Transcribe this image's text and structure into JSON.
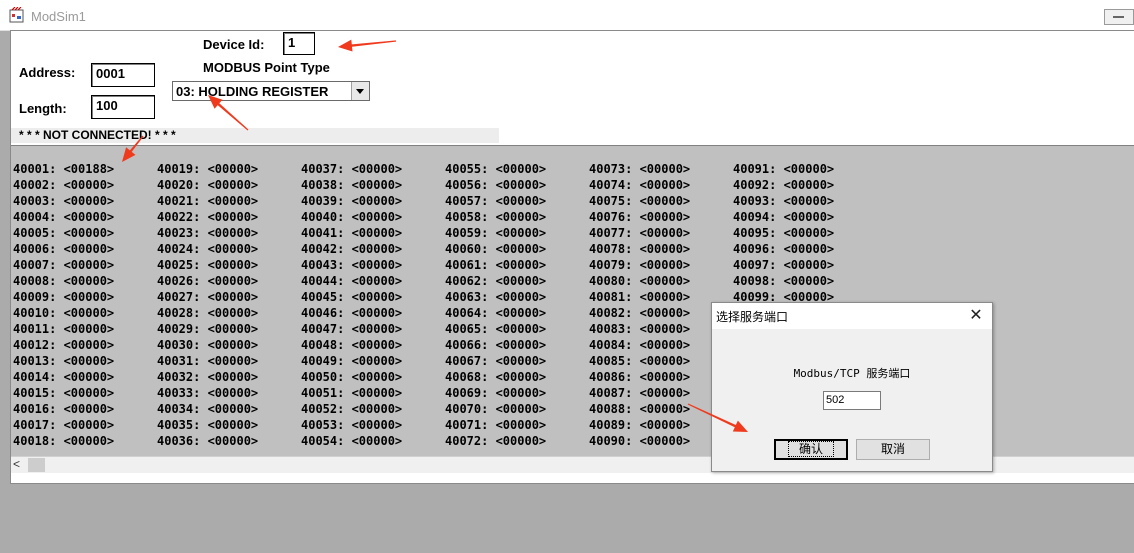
{
  "window": {
    "title": "ModSim1"
  },
  "form": {
    "device_id_label": "Device Id:",
    "device_id_value": "1",
    "point_type_label": "MODBUS Point Type",
    "point_type_value": "03: HOLDING REGISTER",
    "address_label": "Address:",
    "address_value": "0001",
    "length_label": "Length:",
    "length_value": "100",
    "status": "* * * NOT CONNECTED! * * *"
  },
  "registers": [
    [
      "40001: <00188>",
      "40002: <00000>",
      "40003: <00000>",
      "40004: <00000>",
      "40005: <00000>",
      "40006: <00000>",
      "40007: <00000>",
      "40008: <00000>",
      "40009: <00000>",
      "40010: <00000>",
      "40011: <00000>",
      "40012: <00000>",
      "40013: <00000>",
      "40014: <00000>",
      "40015: <00000>",
      "40016: <00000>",
      "40017: <00000>",
      "40018: <00000>"
    ],
    [
      "40019: <00000>",
      "40020: <00000>",
      "40021: <00000>",
      "40022: <00000>",
      "40023: <00000>",
      "40024: <00000>",
      "40025: <00000>",
      "40026: <00000>",
      "40027: <00000>",
      "40028: <00000>",
      "40029: <00000>",
      "40030: <00000>",
      "40031: <00000>",
      "40032: <00000>",
      "40033: <00000>",
      "40034: <00000>",
      "40035: <00000>",
      "40036: <00000>"
    ],
    [
      "40037: <00000>",
      "40038: <00000>",
      "40039: <00000>",
      "40040: <00000>",
      "40041: <00000>",
      "40042: <00000>",
      "40043: <00000>",
      "40044: <00000>",
      "40045: <00000>",
      "40046: <00000>",
      "40047: <00000>",
      "40048: <00000>",
      "40049: <00000>",
      "40050: <00000>",
      "40051: <00000>",
      "40052: <00000>",
      "40053: <00000>",
      "40054: <00000>"
    ],
    [
      "40055: <00000>",
      "40056: <00000>",
      "40057: <00000>",
      "40058: <00000>",
      "40059: <00000>",
      "40060: <00000>",
      "40061: <00000>",
      "40062: <00000>",
      "40063: <00000>",
      "40064: <00000>",
      "40065: <00000>",
      "40066: <00000>",
      "40067: <00000>",
      "40068: <00000>",
      "40069: <00000>",
      "40070: <00000>",
      "40071: <00000>",
      "40072: <00000>"
    ],
    [
      "40073: <00000>",
      "40074: <00000>",
      "40075: <00000>",
      "40076: <00000>",
      "40077: <00000>",
      "40078: <00000>",
      "40079: <00000>",
      "40080: <00000>",
      "40081: <00000>",
      "40082: <00000>",
      "40083: <00000>",
      "40084: <00000>",
      "40085: <00000>",
      "40086: <00000>",
      "40087: <00000>",
      "40088: <00000>",
      "40089: <00000>",
      "40090: <00000>"
    ],
    [
      "40091: <00000>",
      "40092: <00000>",
      "40093: <00000>",
      "40094: <00000>",
      "40095: <00000>",
      "40096: <00000>",
      "40097: <00000>",
      "40098: <00000>",
      "40099: <00000>"
    ]
  ],
  "dialog": {
    "title": "选择服务端口",
    "close_glyph": "✕",
    "label": "Modbus/TCP 服务端口",
    "port_value": "502",
    "ok_label": "确认",
    "cancel_label": "取消"
  },
  "scrollbar": {
    "left_glyph": "<"
  },
  "annotation_color": "#f03a1e"
}
